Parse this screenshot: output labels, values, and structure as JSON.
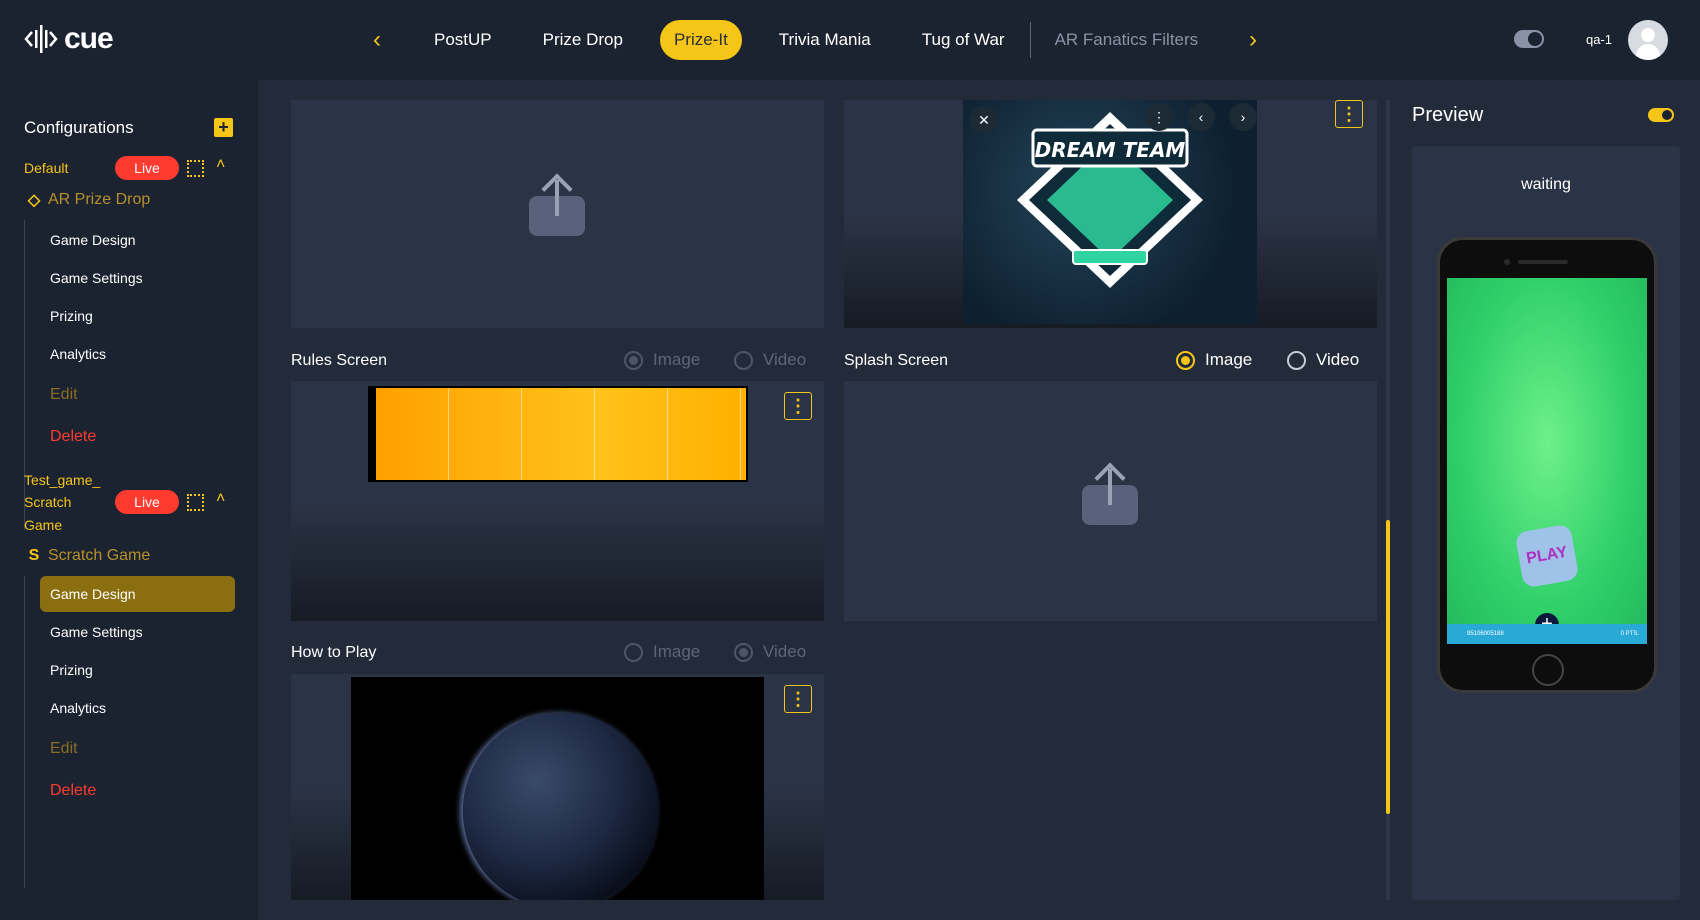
{
  "header": {
    "logo_text": "cue",
    "tabs": [
      {
        "label": "PostUP"
      },
      {
        "label": "Prize Drop"
      },
      {
        "label": "Prize-It"
      },
      {
        "label": "Trivia Mania"
      },
      {
        "label": "Tug of War"
      },
      {
        "label": "AR Fanatics Filters"
      }
    ],
    "active_tab": "Prize-It",
    "user_name": "qa-1"
  },
  "sidebar": {
    "title": "Configurations",
    "configs": [
      {
        "name": "Default",
        "status": "Live",
        "game": "AR Prize Drop",
        "game_icon": "diamond-icon",
        "items": [
          "Game Design",
          "Game Settings",
          "Prizing",
          "Analytics",
          "Edit",
          "Delete"
        ]
      },
      {
        "name_line1": "Test_game_",
        "name_line2": "Scratch",
        "name_line3": "Game",
        "status": "Live",
        "game": "Scratch Game",
        "game_icon": "scratch-s-icon",
        "items": [
          "Game Design",
          "Game Settings",
          "Prizing",
          "Analytics",
          "Edit",
          "Delete"
        ],
        "active_item": "Game Design"
      }
    ]
  },
  "main": {
    "rules_screen": {
      "label": "Rules Screen",
      "option_image": "Image",
      "option_video": "Video",
      "selected": "Image"
    },
    "splash_screen": {
      "label": "Splash Screen",
      "option_image": "Image",
      "option_video": "Video",
      "selected": "Image"
    },
    "how_to_play": {
      "label": "How to Play",
      "option_image": "Image",
      "option_video": "Video",
      "selected": "Video"
    }
  },
  "preview": {
    "title": "Preview",
    "status": "waiting",
    "play_label": "PLAY",
    "bar_left": "95106005188",
    "bar_right": "0 PTS."
  },
  "colors": {
    "accent": "#f5c518",
    "live": "#ff3b30",
    "background": "#1b2230",
    "panel": "#2b3446"
  }
}
